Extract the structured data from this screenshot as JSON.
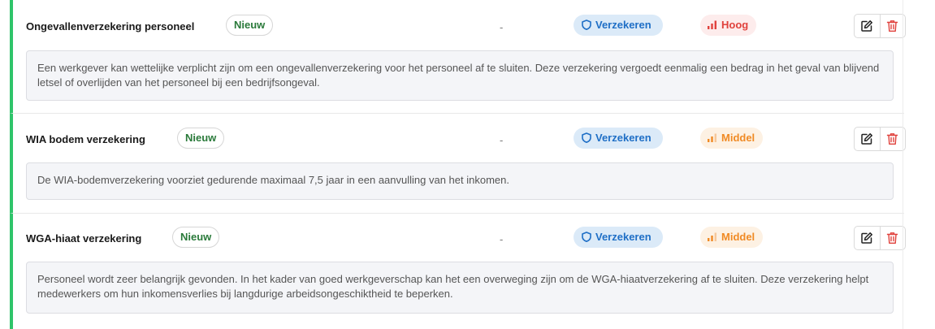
{
  "rows": [
    {
      "name": "Ongevallenverzekering personeel",
      "badge": "Nieuw",
      "dash": "-",
      "action_label": "Verzekeren",
      "priority_label": "Hoog",
      "priority_level": "high",
      "description": "Een werkgever kan wettelijke verplicht zijn om een ongevallenverzekering voor het personeel af te sluiten. Deze verzekering vergoedt eenmalig een bedrag in het geval van blijvend letsel of overlijden van het personeel bij een bedrijfsongeval."
    },
    {
      "name": "WIA bodem verzekering",
      "badge": "Nieuw",
      "dash": "-",
      "action_label": "Verzekeren",
      "priority_label": "Middel",
      "priority_level": "medium",
      "description": "De WIA-bodemverzekering voorziet gedurende maximaal 7,5 jaar in een aanvulling van het inkomen."
    },
    {
      "name": "WGA-hiaat verzekering",
      "badge": "Nieuw",
      "dash": "-",
      "action_label": "Verzekeren",
      "priority_label": "Middel",
      "priority_level": "medium",
      "description": "Personeel wordt zeer belangrijk gevonden. In het kader van goed werkgeverschap kan het een overweging zijn om de WGA-hiaatverzekering af te sluiten. Deze verzekering helpt medewerkers om hun inkomensverlies bij langdurige arbeidsongeschiktheid te beperken."
    }
  ],
  "icons": {
    "insure": "shield-icon",
    "priority": "signal-bars-icon",
    "edit": "edit-icon",
    "delete": "trash-icon"
  },
  "colors": {
    "accent_border": "#2fc46a",
    "badge_text": "#2a7a3a",
    "insure_bg": "#dbeaf8",
    "insure_text": "#1f6fc6",
    "priority_high": "#e0413c",
    "priority_medium": "#f08a24",
    "delete_icon": "#e0413c"
  }
}
